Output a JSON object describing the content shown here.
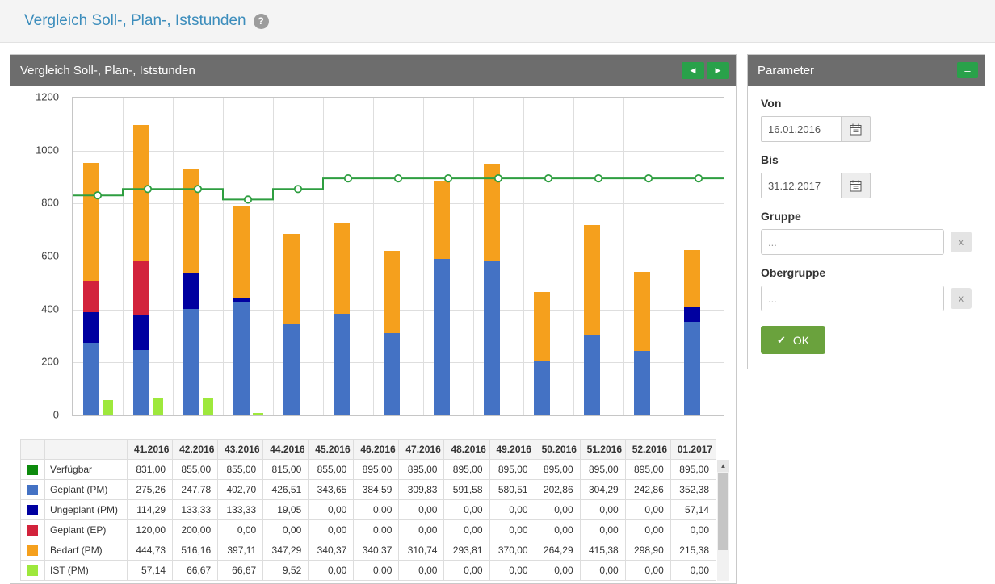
{
  "topbar": {
    "title": "Vergleich Soll-, Plan-, Iststunden",
    "help_icon": "?"
  },
  "chart_panel": {
    "title": "Vergleich Soll-, Plan-, Iststunden",
    "nav_prev": "◀",
    "nav_next": "▶"
  },
  "parameters": {
    "title": "Parameter",
    "collapse_icon": "–",
    "von_label": "Von",
    "von_value": "16.01.2016",
    "bis_label": "Bis",
    "bis_value": "31.12.2017",
    "gruppe_label": "Gruppe",
    "gruppe_placeholder": "...",
    "gruppe_clear": "x",
    "obergruppe_label": "Obergruppe",
    "obergruppe_placeholder": "...",
    "obergruppe_clear": "x",
    "ok_icon": "✔",
    "ok_label": "OK"
  },
  "colors": {
    "title_blue": "#3c8dbc",
    "panel_header_gray": "#6d6d6d",
    "nav_button_green": "#29a14a",
    "ok_button_green": "#6aa23d"
  },
  "chart_data": {
    "type": "bar",
    "stacked": true,
    "grid": true,
    "legend_position": "table-below",
    "categories": [
      "41.2016",
      "42.2016",
      "43.2016",
      "44.2016",
      "45.2016",
      "46.2016",
      "47.2016",
      "48.2016",
      "49.2016",
      "50.2016",
      "51.2016",
      "52.2016",
      "01.2017"
    ],
    "ylim": [
      0,
      1200
    ],
    "yticks": [
      0,
      200,
      400,
      600,
      800,
      1000,
      1200
    ],
    "series": [
      {
        "name": "Verfügbar",
        "type": "line",
        "stack": null,
        "color": "#2e9e40",
        "values": [
          831,
          855,
          855,
          815,
          855,
          895,
          895,
          895,
          895,
          895,
          895,
          895,
          895
        ]
      },
      {
        "name": "Geplant (PM)",
        "type": "bar",
        "stack": "main",
        "color": "#4472c4",
        "values": [
          275.26,
          247.78,
          402.7,
          426.51,
          343.65,
          384.59,
          309.83,
          591.58,
          580.51,
          202.86,
          304.29,
          242.86,
          352.38
        ]
      },
      {
        "name": "Ungeplant (PM)",
        "type": "bar",
        "stack": "main",
        "color": "#0000a0",
        "values": [
          114.29,
          133.33,
          133.33,
          19.05,
          0,
          0,
          0,
          0,
          0,
          0,
          0,
          0,
          57.14
        ]
      },
      {
        "name": "Geplant (EP)",
        "type": "bar",
        "stack": "main",
        "color": "#d2233c",
        "values": [
          120,
          200,
          0,
          0,
          0,
          0,
          0,
          0,
          0,
          0,
          0,
          0,
          0
        ]
      },
      {
        "name": "Bedarf (PM)",
        "type": "bar",
        "stack": "main",
        "color": "#f5a01d",
        "values": [
          444.73,
          516.16,
          397.11,
          347.29,
          340.37,
          340.37,
          310.74,
          293.81,
          370,
          264.29,
          415.38,
          298.9,
          215.38
        ]
      },
      {
        "name": "IST (PM)",
        "type": "bar",
        "stack": "ist",
        "color": "#9ee83c",
        "values": [
          57.14,
          66.67,
          66.67,
          9.52,
          0,
          0,
          0,
          0,
          0,
          0,
          0,
          0,
          0
        ]
      }
    ]
  },
  "table": {
    "scroll_up": "▲",
    "columns": [
      "41.2016",
      "42.2016",
      "43.2016",
      "44.2016",
      "45.2016",
      "46.2016",
      "47.2016",
      "48.2016",
      "49.2016",
      "50.2016",
      "51.2016",
      "52.2016",
      "01.2017"
    ],
    "rows": [
      {
        "label": "Verfügbar",
        "swatch": "#0d8a0d",
        "values": [
          "831,00",
          "855,00",
          "855,00",
          "815,00",
          "855,00",
          "895,00",
          "895,00",
          "895,00",
          "895,00",
          "895,00",
          "895,00",
          "895,00",
          "895,00"
        ]
      },
      {
        "label": "Geplant (PM)",
        "swatch": "#4472c4",
        "values": [
          "275,26",
          "247,78",
          "402,70",
          "426,51",
          "343,65",
          "384,59",
          "309,83",
          "591,58",
          "580,51",
          "202,86",
          "304,29",
          "242,86",
          "352,38"
        ]
      },
      {
        "label": "Ungeplant (PM)",
        "swatch": "#0000a0",
        "values": [
          "114,29",
          "133,33",
          "133,33",
          "19,05",
          "0,00",
          "0,00",
          "0,00",
          "0,00",
          "0,00",
          "0,00",
          "0,00",
          "0,00",
          "57,14"
        ]
      },
      {
        "label": "Geplant (EP)",
        "swatch": "#d2233c",
        "values": [
          "120,00",
          "200,00",
          "0,00",
          "0,00",
          "0,00",
          "0,00",
          "0,00",
          "0,00",
          "0,00",
          "0,00",
          "0,00",
          "0,00",
          "0,00"
        ]
      },
      {
        "label": "Bedarf (PM)",
        "swatch": "#f5a01d",
        "values": [
          "444,73",
          "516,16",
          "397,11",
          "347,29",
          "340,37",
          "340,37",
          "310,74",
          "293,81",
          "370,00",
          "264,29",
          "415,38",
          "298,90",
          "215,38"
        ]
      },
      {
        "label": "IST (PM)",
        "swatch": "#9ee83c",
        "values": [
          "57,14",
          "66,67",
          "66,67",
          "9,52",
          "0,00",
          "0,00",
          "0,00",
          "0,00",
          "0,00",
          "0,00",
          "0,00",
          "0,00",
          "0,00"
        ]
      }
    ]
  }
}
